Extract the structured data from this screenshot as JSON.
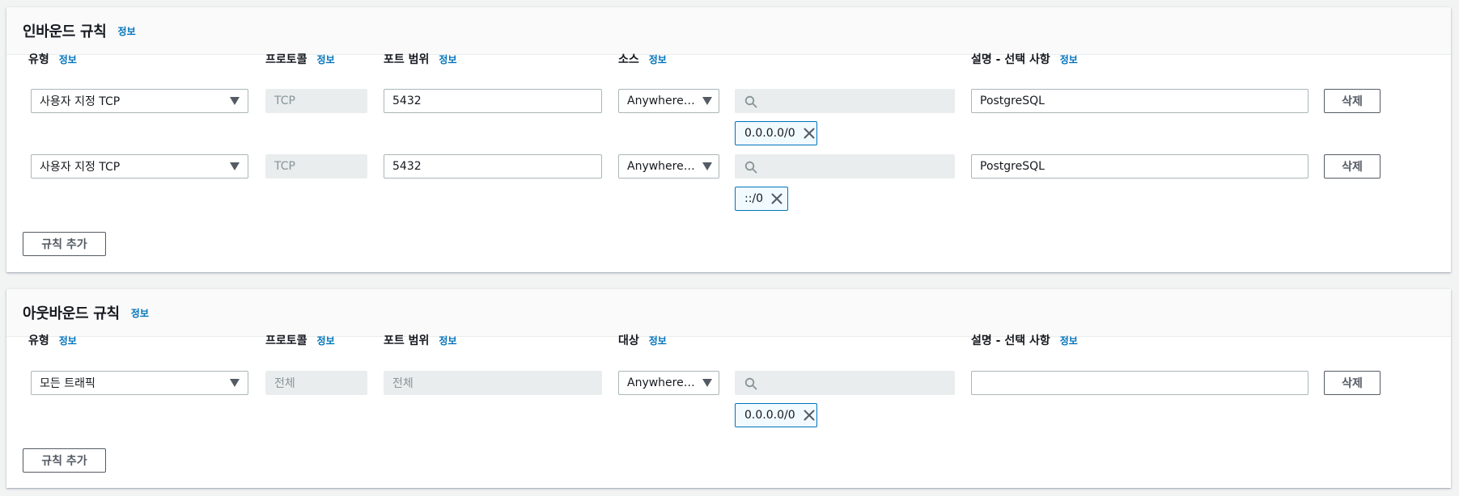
{
  "inbound": {
    "title": "인바운드 규칙",
    "info": "정보",
    "columns": {
      "type": "유형",
      "protocol": "프로토콜",
      "port_range": "포트 범위",
      "source": "소스",
      "description": "설명 - 선택 사항"
    },
    "rows": [
      {
        "type": "사용자 지정 TCP",
        "protocol": "TCP",
        "port_range": "5432",
        "source": "Anywhere-I...",
        "search_placeholder": "",
        "token": "0.0.0.0/0",
        "description": "PostgreSQL",
        "delete_label": "삭제"
      },
      {
        "type": "사용자 지정 TCP",
        "protocol": "TCP",
        "port_range": "5432",
        "source": "Anywhere-I...",
        "search_placeholder": "",
        "token": "::/0",
        "description": "PostgreSQL",
        "delete_label": "삭제"
      }
    ],
    "add_rule_label": "규칙 추가"
  },
  "outbound": {
    "title": "아웃바운드 규칙",
    "info": "정보",
    "columns": {
      "type": "유형",
      "protocol": "프로토콜",
      "port_range": "포트 범위",
      "destination": "대상",
      "description": "설명 - 선택 사항"
    },
    "rows": [
      {
        "type": "모든 트래픽",
        "protocol": "전체",
        "port_range": "전체",
        "destination": "Anywhere-I...",
        "search_placeholder": "",
        "token": "0.0.0.0/0",
        "description": "",
        "delete_label": "삭제"
      }
    ],
    "add_rule_label": "규칙 추가"
  },
  "icons": {
    "search": "search-icon",
    "caret": "caret-down-icon",
    "remove": "close-icon"
  },
  "colors": {
    "link": "#0073bb",
    "token_border": "#0073bb",
    "disabled_bg": "#eaeded",
    "input_border": "#aab7b8"
  }
}
